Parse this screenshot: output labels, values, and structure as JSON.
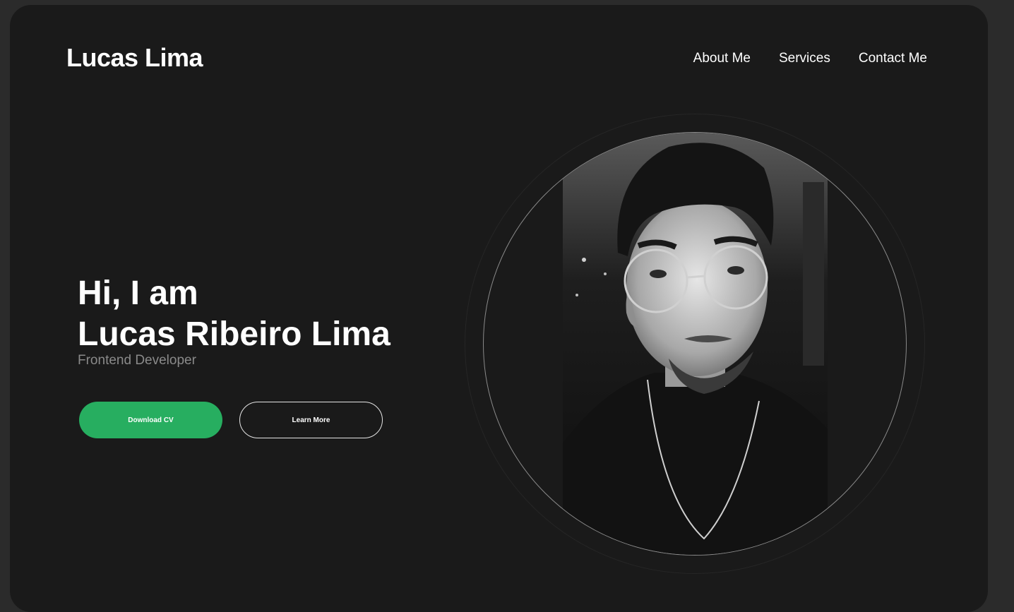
{
  "header": {
    "logo": "Lucas Lima",
    "nav": [
      {
        "label": "About Me"
      },
      {
        "label": "Services"
      },
      {
        "label": "Contact Me"
      }
    ]
  },
  "hero": {
    "greeting_line1": "Hi, I am",
    "greeting_line2": "Lucas Ribeiro Lima",
    "role": "Frontend Developer",
    "primary_button": "Download CV",
    "secondary_button": "Learn More"
  },
  "colors": {
    "background": "#1a1a1a",
    "accent": "#27ae60",
    "text": "#ffffff",
    "muted": "#8a8a8a"
  },
  "icons": {
    "profile": "profile-photo"
  }
}
